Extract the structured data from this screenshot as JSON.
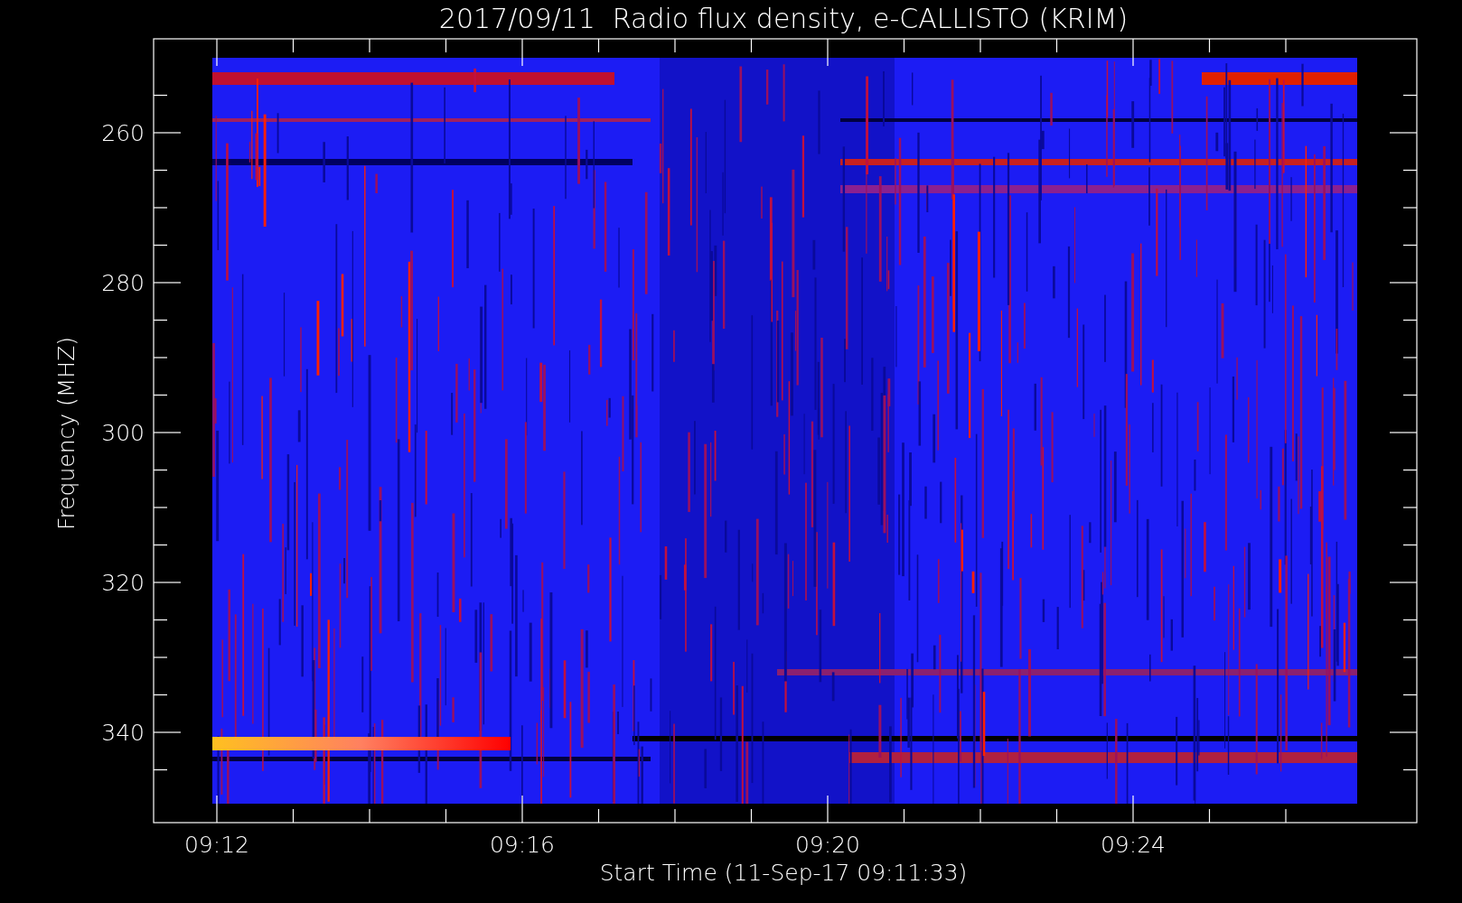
{
  "title": "2017/09/11  Radio flux density, e-CALLISTO (KRIM)",
  "y_axis": {
    "label": "Frequency (MHZ)",
    "ticks": [
      "260",
      "280",
      "300",
      "320",
      "340"
    ]
  },
  "x_axis": {
    "label": "Start Time (11-Sep-17 09:11:33)",
    "ticks": [
      "09:12",
      "09:16",
      "09:20",
      "09:24"
    ]
  }
}
